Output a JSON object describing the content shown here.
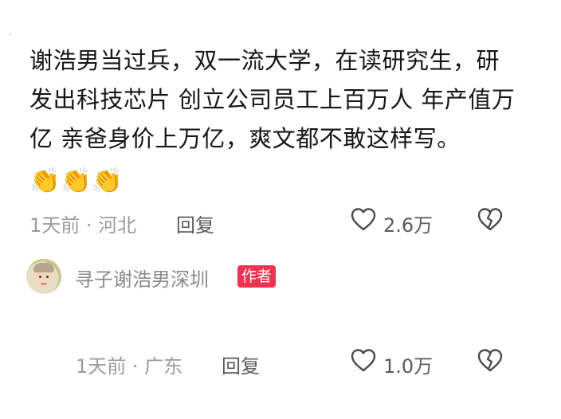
{
  "comment": {
    "text": "谢浩男当过兵，双一流大学，在读研究生，研发出科技芯片 创立公司员工上百万人 年产值万亿  亲爸身价上万亿，爽文都不敢这样写。",
    "emoji": "👏👏👏",
    "time_location": "1天前 · 河北",
    "reply_label": "回复",
    "like_count": "2.6万",
    "like_icon": "heart-outline-icon",
    "dislike_icon": "broken-heart-icon"
  },
  "reply": {
    "author_name": "寻子谢浩男深圳",
    "author_badge": "作者",
    "time_location": "1天前 · 广东",
    "reply_label": "回复",
    "like_count": "1.0万",
    "like_icon": "heart-outline-icon",
    "dislike_icon": "broken-heart-icon"
  },
  "colors": {
    "text": "#161616",
    "meta": "#9b9b9b",
    "action": "#5a5a5a",
    "badge": "#f4304f"
  }
}
